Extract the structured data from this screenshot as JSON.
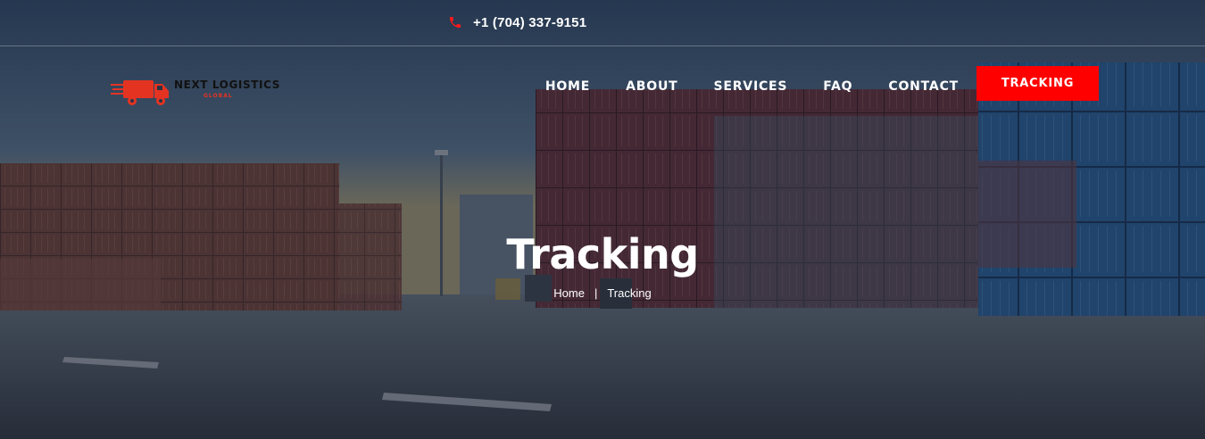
{
  "topbar": {
    "phone_icon": "phone-icon",
    "phone": "+1 (704) 337-9151"
  },
  "brand": {
    "name": "NEXT LOGISTICS",
    "sub": "GLOBAL",
    "icon": "truck-icon",
    "accent_color": "#e53322"
  },
  "nav": {
    "items": [
      "HOME",
      "ABOUT",
      "SERVICES",
      "FAQ",
      "CONTACT"
    ],
    "cta": "TRACKING",
    "cta_color": "#ff0000"
  },
  "hero": {
    "title": "Tracking",
    "breadcrumb": {
      "home": "Home",
      "separator": "|",
      "current": "Tracking"
    }
  }
}
